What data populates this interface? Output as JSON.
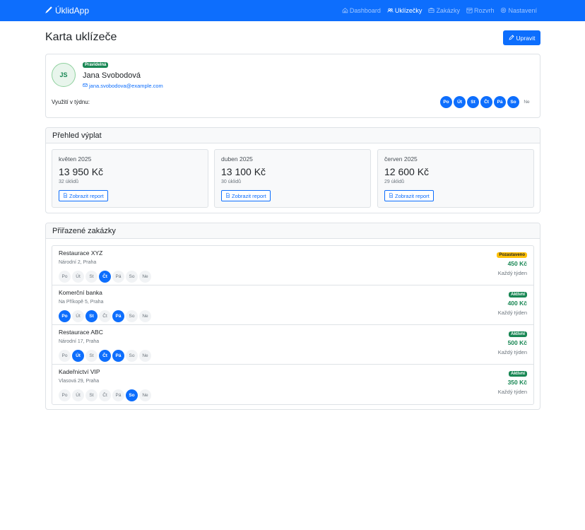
{
  "navbar": {
    "brand": "ÚklidApp",
    "items": [
      {
        "label": "Dashboard",
        "icon": "house-icon",
        "active": false
      },
      {
        "label": "Uklízečky",
        "icon": "people-icon",
        "active": true
      },
      {
        "label": "Zakázky",
        "icon": "briefcase-icon",
        "active": false
      },
      {
        "label": "Rozvrh",
        "icon": "calendar-icon",
        "active": false
      },
      {
        "label": "Nastavení",
        "icon": "gear-icon",
        "active": false
      }
    ]
  },
  "header": {
    "title": "Karta uklízeče",
    "edit_label": "Upravit"
  },
  "profile": {
    "initials": "JS",
    "badge": "Pravidelná",
    "name": "Jana Svobodová",
    "email": "jana.svobodova@example.com",
    "usage_label": "Využití v týdnu:",
    "week": [
      {
        "label": "Po",
        "on": true
      },
      {
        "label": "Út",
        "on": true
      },
      {
        "label": "St",
        "on": true
      },
      {
        "label": "Čt",
        "on": true
      },
      {
        "label": "Pá",
        "on": true
      },
      {
        "label": "So",
        "on": true
      },
      {
        "label": "Ne",
        "on": false
      }
    ]
  },
  "payouts": {
    "title": "Přehled výplat",
    "items": [
      {
        "month": "květen 2025",
        "amount": "13 950 Kč",
        "count": "32 úklidů",
        "button": "Zobrazit report"
      },
      {
        "month": "duben 2025",
        "amount": "13 100 Kč",
        "count": "30 úklidů",
        "button": "Zobrazit report"
      },
      {
        "month": "červen 2025",
        "amount": "12 600 Kč",
        "count": "29 úklidů",
        "button": "Zobrazit report"
      }
    ]
  },
  "orders": {
    "title": "Přiřazené zakázky",
    "items": [
      {
        "name": "Restaurace XYZ",
        "address": "Národní 2, Praha",
        "status": "Pozastaveno",
        "status_color": "#ffc107",
        "price": "450 Kč",
        "frequency": "Každý týden",
        "days": [
          {
            "label": "Po",
            "on": false
          },
          {
            "label": "Út",
            "on": false
          },
          {
            "label": "St",
            "on": false
          },
          {
            "label": "Čt",
            "on": true
          },
          {
            "label": "Pá",
            "on": false
          },
          {
            "label": "So",
            "on": false
          },
          {
            "label": "Ne",
            "on": false
          }
        ]
      },
      {
        "name": "Komerční banka",
        "address": "Na Příkopě 5, Praha",
        "status": "Aktivní",
        "status_color": "#198754",
        "price": "400 Kč",
        "frequency": "Každý týden",
        "days": [
          {
            "label": "Po",
            "on": true
          },
          {
            "label": "Út",
            "on": false
          },
          {
            "label": "St",
            "on": true
          },
          {
            "label": "Čt",
            "on": false
          },
          {
            "label": "Pá",
            "on": true
          },
          {
            "label": "So",
            "on": false
          },
          {
            "label": "Ne",
            "on": false
          }
        ]
      },
      {
        "name": "Restaurace ABC",
        "address": "Národní 17, Praha",
        "status": "Aktivní",
        "status_color": "#198754",
        "price": "500 Kč",
        "frequency": "Každý týden",
        "days": [
          {
            "label": "Po",
            "on": false
          },
          {
            "label": "Út",
            "on": true
          },
          {
            "label": "St",
            "on": false
          },
          {
            "label": "Čt",
            "on": true
          },
          {
            "label": "Pá",
            "on": true
          },
          {
            "label": "So",
            "on": false
          },
          {
            "label": "Ne",
            "on": false
          }
        ]
      },
      {
        "name": "Kadeřnictví VIP",
        "address": "Vlasová 29, Praha",
        "status": "Aktivní",
        "status_color": "#198754",
        "price": "350 Kč",
        "frequency": "Každý týden",
        "days": [
          {
            "label": "Po",
            "on": false
          },
          {
            "label": "Út",
            "on": false
          },
          {
            "label": "St",
            "on": false
          },
          {
            "label": "Čt",
            "on": false
          },
          {
            "label": "Pá",
            "on": false
          },
          {
            "label": "So",
            "on": true
          },
          {
            "label": "Ne",
            "on": false
          }
        ]
      }
    ]
  }
}
